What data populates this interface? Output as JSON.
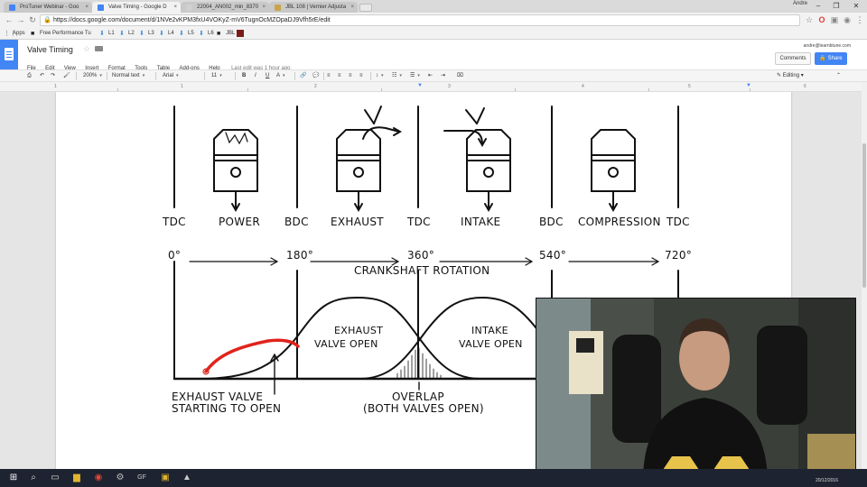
{
  "tabs": [
    {
      "title": "ProTuner Webinar - Goo",
      "color": "#4285f4"
    },
    {
      "title": "Valve Timing - Google D",
      "color": "#4285f4",
      "active": true
    },
    {
      "title": "22004_AN002_min_8370",
      "color": "#d0d0d0"
    },
    {
      "title": "JBL 108 | Vernier Adjusta",
      "color": "#c9a44a"
    }
  ],
  "window": {
    "user": "Andre",
    "minimize": "–",
    "maximize": "❐",
    "close": "✕",
    "tab_close": "×"
  },
  "address": {
    "url": "https://docs.google.com/document/d/1NVe2vKPM3fxU4VOKyZ-mV6TugnOcMZOpaDJ9Vfh5rE/edit"
  },
  "bookmarks": [
    "Apps",
    "Free Performance Tu",
    "L1",
    "L2",
    "L3",
    "L4",
    "L5",
    "L6",
    "JBL"
  ],
  "doc": {
    "title": "Valve Timing",
    "menus": [
      "File",
      "Edit",
      "View",
      "Insert",
      "Format",
      "Tools",
      "Table",
      "Add-ons",
      "Help"
    ],
    "last_edit": "Last edit was 1 hour ago",
    "account": "andre@learnbtune.com",
    "comments_label": "Comments",
    "share_label": "Share"
  },
  "toolbar": {
    "zoom": "200%",
    "style": "Normal text",
    "font": "Arial",
    "size": "11",
    "mode": "Editing",
    "bold": "B",
    "italic": "I",
    "underline": "U",
    "textcolor": "A"
  },
  "ruler": [
    "1",
    "1",
    "2",
    "3",
    "4",
    "5",
    "6"
  ],
  "diagram": {
    "tdc1": "TDC",
    "bdc1": "BDC",
    "tdc2": "TDC",
    "bdc2": "BDC",
    "tdc3": "TDC",
    "power": "POWER",
    "exhaust": "EXHAUST",
    "intake": "INTAKE",
    "compression": "COMPRESSION",
    "deg0": "0°",
    "deg180": "180°",
    "deg360": "360°",
    "deg540": "540°",
    "deg720": "720°",
    "crankshaft": "CRANKSHAFT ROTATION",
    "exhaust_open_1": "EXHAUST",
    "exhaust_open_2": "VALVE OPEN",
    "intake_open_1": "INTAKE",
    "intake_open_2": "VALVE OPEN",
    "ev_start_1": "EXHAUST VALVE",
    "ev_start_2": "STARTING TO OPEN",
    "overlap_1": "OVERLAP",
    "overlap_2": "(BOTH VALVES OPEN)"
  },
  "taskbar": {
    "time": "20/12/2016"
  }
}
